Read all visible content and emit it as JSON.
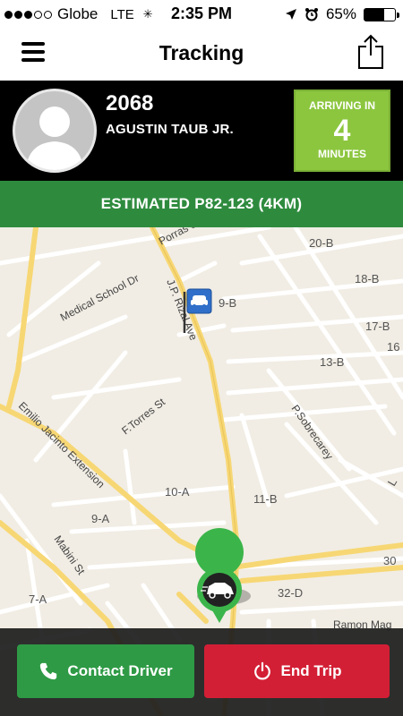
{
  "status_bar": {
    "carrier": "Globe",
    "network": "LTE",
    "time": "2:35 PM",
    "battery": "65%",
    "battery_level": 0.65,
    "signal_bars_filled": 3,
    "signal_bars_total": 5
  },
  "nav": {
    "title": "Tracking"
  },
  "driver": {
    "number": "2068",
    "name": "AGUSTIN TAUB JR.",
    "arrival_label": "ARRIVING IN",
    "arrival_value": "4",
    "arrival_unit": "MINUTES"
  },
  "fare": {
    "text": "ESTIMATED P82-123 (4KM)"
  },
  "map": {
    "streets": {
      "porras": "Porras St",
      "medical_school": "Medical School Dr",
      "jp_rizal": "J.P. Rizal Ave",
      "emilio_jacinto": "Emilio Jacinto Extension",
      "ftorres": "F.Torres St",
      "psobrecarey": "P.Sobrecarey",
      "mabini": "Mabini St",
      "ramon_mag": "Ramon Mag"
    },
    "blocks": {
      "b20": "20-B",
      "b18": "18-B",
      "b17": "17-B",
      "b16": "16",
      "b13": "13-B",
      "b9": "9-B",
      "a10": "10-A",
      "b11": "11-B",
      "a9": "9-A",
      "n30": "30",
      "d32": "32-D",
      "a7": "7-A",
      "edge_l": "L"
    }
  },
  "actions": {
    "contact_label": "Contact Driver",
    "end_label": "End Trip"
  },
  "colors": {
    "arrival_green": "#8cc63f",
    "fare_green": "#2e8b3e",
    "contact_green": "#2e9a45",
    "end_red": "#d31f35",
    "taxi_pin_green": "#3bb54a"
  }
}
